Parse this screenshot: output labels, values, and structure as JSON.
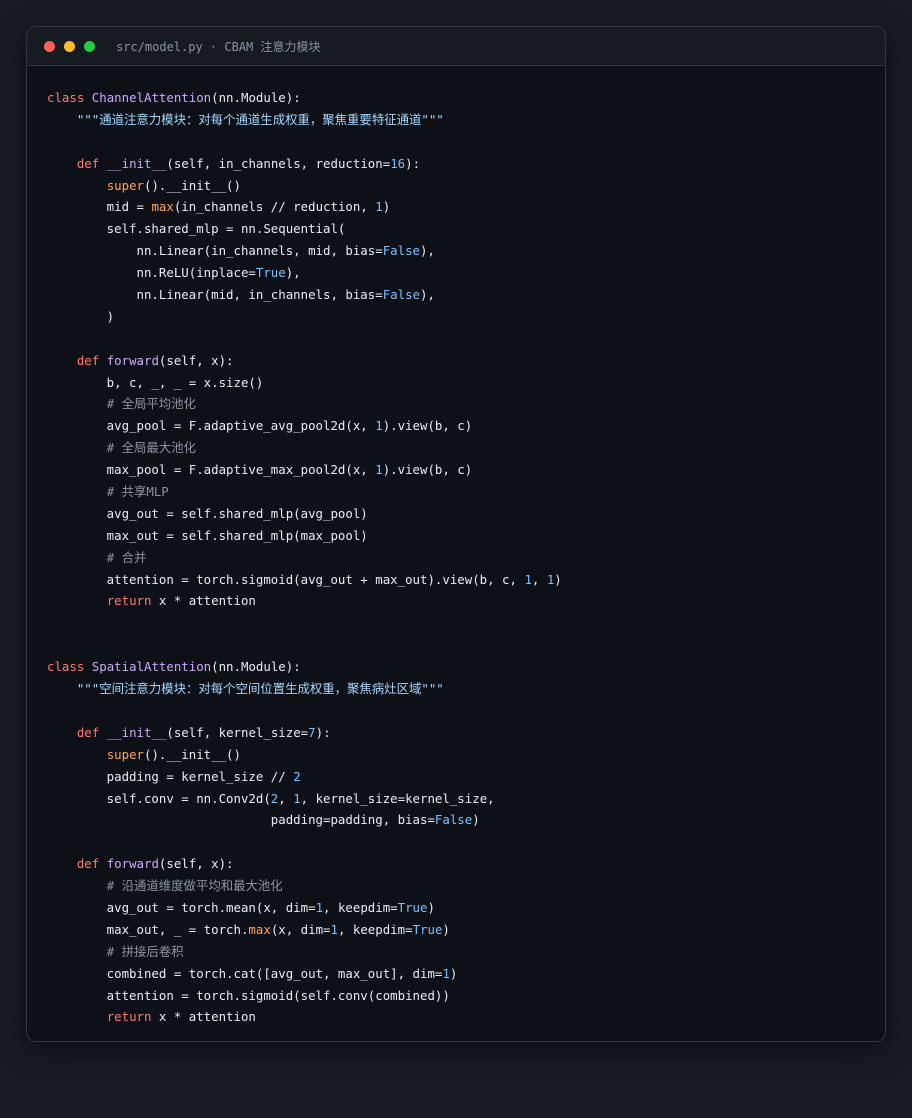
{
  "window": {
    "title": "src/model.py · CBAM 注意力模块",
    "buttons": {
      "close_color": "#ff5f56",
      "minimize_color": "#ffbd2e",
      "maximize_color": "#27c93f"
    }
  },
  "theme": {
    "background": "#0d1117",
    "keyword": "#ff7b72",
    "function": "#d2a8ff",
    "builtin": "#ffa657",
    "number": "#79c0ff",
    "string": "#a5d6ff",
    "comment": "#8b949e"
  },
  "code_lines": [
    [
      [
        "kw",
        "class"
      ],
      [
        "pl",
        " "
      ],
      [
        "cls",
        "ChannelAttention"
      ],
      [
        "pl",
        "(nn.Module):"
      ]
    ],
    [
      [
        "pl",
        "    "
      ],
      [
        "str",
        "\"\"\"通道注意力模块：对每个通道生成权重，聚焦重要特征通道\"\"\""
      ]
    ],
    [],
    [
      [
        "pl",
        "    "
      ],
      [
        "kw",
        "def"
      ],
      [
        "pl",
        " "
      ],
      [
        "fn",
        "__init__"
      ],
      [
        "pl",
        "(self, in_channels, reduction="
      ],
      [
        "num",
        "16"
      ],
      [
        "pl",
        "):"
      ]
    ],
    [
      [
        "pl",
        "        "
      ],
      [
        "bi",
        "super"
      ],
      [
        "pl",
        "().__init__()"
      ]
    ],
    [
      [
        "pl",
        "        mid = "
      ],
      [
        "bi",
        "max"
      ],
      [
        "pl",
        "(in_channels // reduction, "
      ],
      [
        "num",
        "1"
      ],
      [
        "pl",
        ")"
      ]
    ],
    [
      [
        "pl",
        "        self.shared_mlp = nn.Sequential("
      ]
    ],
    [
      [
        "pl",
        "            nn.Linear(in_channels, mid, bias="
      ],
      [
        "cst",
        "False"
      ],
      [
        "pl",
        "),"
      ]
    ],
    [
      [
        "pl",
        "            nn.ReLU(inplace="
      ],
      [
        "cst",
        "True"
      ],
      [
        "pl",
        "),"
      ]
    ],
    [
      [
        "pl",
        "            nn.Linear(mid, in_channels, bias="
      ],
      [
        "cst",
        "False"
      ],
      [
        "pl",
        "),"
      ]
    ],
    [
      [
        "pl",
        "        )"
      ]
    ],
    [],
    [
      [
        "pl",
        "    "
      ],
      [
        "kw",
        "def"
      ],
      [
        "pl",
        " "
      ],
      [
        "fn",
        "forward"
      ],
      [
        "pl",
        "(self, x):"
      ]
    ],
    [
      [
        "pl",
        "        b, c, _, _ = x.size()"
      ]
    ],
    [
      [
        "pl",
        "        "
      ],
      [
        "cm",
        "# 全局平均池化"
      ]
    ],
    [
      [
        "pl",
        "        avg_pool = F.adaptive_avg_pool2d(x, "
      ],
      [
        "num",
        "1"
      ],
      [
        "pl",
        ").view(b, c)"
      ]
    ],
    [
      [
        "pl",
        "        "
      ],
      [
        "cm",
        "# 全局最大池化"
      ]
    ],
    [
      [
        "pl",
        "        max_pool = F.adaptive_max_pool2d(x, "
      ],
      [
        "num",
        "1"
      ],
      [
        "pl",
        ").view(b, c)"
      ]
    ],
    [
      [
        "pl",
        "        "
      ],
      [
        "cm",
        "# 共享MLP"
      ]
    ],
    [
      [
        "pl",
        "        avg_out = self.shared_mlp(avg_pool)"
      ]
    ],
    [
      [
        "pl",
        "        max_out = self.shared_mlp(max_pool)"
      ]
    ],
    [
      [
        "pl",
        "        "
      ],
      [
        "cm",
        "# 合并"
      ]
    ],
    [
      [
        "pl",
        "        attention = torch.sigmoid(avg_out + max_out).view(b, c, "
      ],
      [
        "num",
        "1"
      ],
      [
        "pl",
        ", "
      ],
      [
        "num",
        "1"
      ],
      [
        "pl",
        ")"
      ]
    ],
    [
      [
        "pl",
        "        "
      ],
      [
        "kw",
        "return"
      ],
      [
        "pl",
        " x * attention"
      ]
    ],
    [],
    [],
    [
      [
        "kw",
        "class"
      ],
      [
        "pl",
        " "
      ],
      [
        "cls",
        "SpatialAttention"
      ],
      [
        "pl",
        "(nn.Module):"
      ]
    ],
    [
      [
        "pl",
        "    "
      ],
      [
        "str",
        "\"\"\"空间注意力模块：对每个空间位置生成权重，聚焦病灶区域\"\"\""
      ]
    ],
    [],
    [
      [
        "pl",
        "    "
      ],
      [
        "kw",
        "def"
      ],
      [
        "pl",
        " "
      ],
      [
        "fn",
        "__init__"
      ],
      [
        "pl",
        "(self, kernel_size="
      ],
      [
        "num",
        "7"
      ],
      [
        "pl",
        "):"
      ]
    ],
    [
      [
        "pl",
        "        "
      ],
      [
        "bi",
        "super"
      ],
      [
        "pl",
        "().__init__()"
      ]
    ],
    [
      [
        "pl",
        "        padding = kernel_size // "
      ],
      [
        "num",
        "2"
      ]
    ],
    [
      [
        "pl",
        "        self.conv = nn.Conv2d("
      ],
      [
        "num",
        "2"
      ],
      [
        "pl",
        ", "
      ],
      [
        "num",
        "1"
      ],
      [
        "pl",
        ", kernel_size=kernel_size,"
      ]
    ],
    [
      [
        "pl",
        "                              padding=padding, bias="
      ],
      [
        "cst",
        "False"
      ],
      [
        "pl",
        ")"
      ]
    ],
    [],
    [
      [
        "pl",
        "    "
      ],
      [
        "kw",
        "def"
      ],
      [
        "pl",
        " "
      ],
      [
        "fn",
        "forward"
      ],
      [
        "pl",
        "(self, x):"
      ]
    ],
    [
      [
        "pl",
        "        "
      ],
      [
        "cm",
        "# 沿通道维度做平均和最大池化"
      ]
    ],
    [
      [
        "pl",
        "        avg_out = torch.mean(x, dim="
      ],
      [
        "num",
        "1"
      ],
      [
        "pl",
        ", keepdim="
      ],
      [
        "cst",
        "True"
      ],
      [
        "pl",
        ")"
      ]
    ],
    [
      [
        "pl",
        "        max_out, _ = torch."
      ],
      [
        "bi",
        "max"
      ],
      [
        "pl",
        "(x, dim="
      ],
      [
        "num",
        "1"
      ],
      [
        "pl",
        ", keepdim="
      ],
      [
        "cst",
        "True"
      ],
      [
        "pl",
        ")"
      ]
    ],
    [
      [
        "pl",
        "        "
      ],
      [
        "cm",
        "# 拼接后卷积"
      ]
    ],
    [
      [
        "pl",
        "        combined = torch.cat([avg_out, max_out], dim="
      ],
      [
        "num",
        "1"
      ],
      [
        "pl",
        ")"
      ]
    ],
    [
      [
        "pl",
        "        attention = torch.sigmoid(self.conv(combined))"
      ]
    ],
    [
      [
        "pl",
        "        "
      ],
      [
        "kw",
        "return"
      ],
      [
        "pl",
        " x * attention"
      ]
    ]
  ]
}
